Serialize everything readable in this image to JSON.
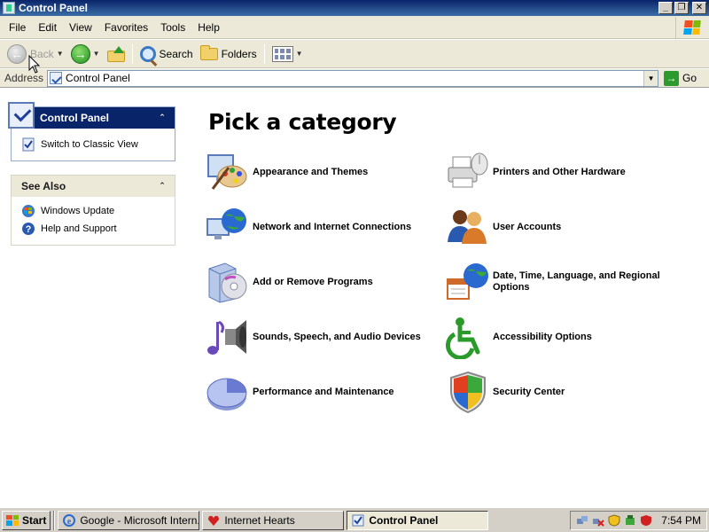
{
  "window": {
    "title": "Control Panel"
  },
  "menu": [
    "File",
    "Edit",
    "View",
    "Favorites",
    "Tools",
    "Help"
  ],
  "toolbar": {
    "back": "Back",
    "search": "Search",
    "folders": "Folders"
  },
  "address": {
    "label": "Address",
    "value": "Control Panel",
    "go": "Go"
  },
  "sidebar": {
    "control_panel": {
      "title": "Control Panel",
      "switch_label": "Switch to Classic View"
    },
    "see_also": {
      "title": "See Also",
      "links": [
        "Windows Update",
        "Help and Support"
      ]
    }
  },
  "main": {
    "heading": "Pick a category",
    "categories": [
      {
        "label": "Appearance and Themes",
        "icon": "appearance-icon"
      },
      {
        "label": "Printers and Other Hardware",
        "icon": "printer-icon"
      },
      {
        "label": "Network and Internet Connections",
        "icon": "network-icon"
      },
      {
        "label": "User Accounts",
        "icon": "users-icon"
      },
      {
        "label": "Add or Remove Programs",
        "icon": "programs-icon"
      },
      {
        "label": "Date, Time, Language, and Regional Options",
        "icon": "date-time-icon"
      },
      {
        "label": "Sounds, Speech, and Audio Devices",
        "icon": "sound-icon"
      },
      {
        "label": "Accessibility Options",
        "icon": "accessibility-icon"
      },
      {
        "label": "Performance and Maintenance",
        "icon": "performance-icon"
      },
      {
        "label": "Security Center",
        "icon": "security-shield-icon"
      }
    ]
  },
  "taskbar": {
    "start": "Start",
    "tasks": [
      "Google - Microsoft Intern...",
      "Internet Hearts",
      "Control Panel"
    ],
    "clock": "7:54 PM"
  },
  "colors": {
    "title_bar": "#0a246a",
    "panel_header": "#0a246a",
    "chrome": "#ece9d8",
    "taskbar": "#d4d0c8"
  }
}
